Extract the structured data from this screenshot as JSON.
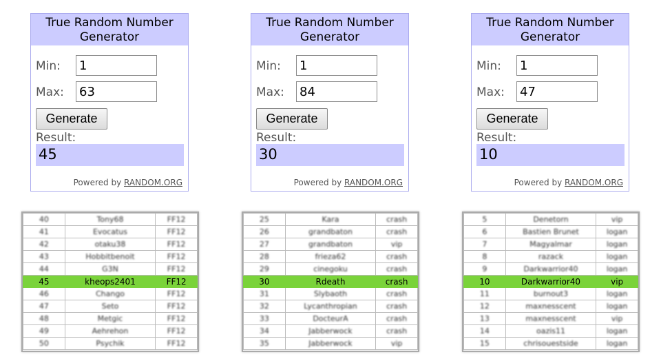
{
  "generators": [
    {
      "title": "True Random Number Generator",
      "min_label": "Min:",
      "min_value": "1",
      "max_label": "Max:",
      "max_value": "63",
      "button_label": "Generate",
      "result_label": "Result:",
      "result_value": "45",
      "powered_by": "Powered by",
      "powered_link": "RANDOM.ORG"
    },
    {
      "title": "True Random Number Generator",
      "min_label": "Min:",
      "min_value": "1",
      "max_label": "Max:",
      "max_value": "84",
      "button_label": "Generate",
      "result_label": "Result:",
      "result_value": "30",
      "powered_by": "Powered by",
      "powered_link": "RANDOM.ORG"
    },
    {
      "title": "True Random Number Generator",
      "min_label": "Min:",
      "min_value": "1",
      "max_label": "Max:",
      "max_value": "47",
      "button_label": "Generate",
      "result_label": "Result:",
      "result_value": "10",
      "powered_by": "Powered by",
      "powered_link": "RANDOM.ORG"
    }
  ],
  "tables": [
    {
      "highlight_row": 5,
      "rows": [
        [
          "40",
          "Tony68",
          "FF12"
        ],
        [
          "41",
          "Evocatus",
          "FF12"
        ],
        [
          "42",
          "otaku38",
          "FF12"
        ],
        [
          "43",
          "Hobbitbenoit",
          "FF12"
        ],
        [
          "44",
          "G3N",
          "FF12"
        ],
        [
          "45",
          "kheops2401",
          "FF12"
        ],
        [
          "46",
          "Chango",
          "FF12"
        ],
        [
          "47",
          "Seto",
          "FF12"
        ],
        [
          "48",
          "Metgic",
          "FF12"
        ],
        [
          "49",
          "Aehrehon",
          "FF12"
        ],
        [
          "50",
          "Psychik",
          "FF12"
        ]
      ]
    },
    {
      "highlight_row": 5,
      "rows": [
        [
          "25",
          "Kara",
          "crash"
        ],
        [
          "26",
          "grandbaton",
          "crash"
        ],
        [
          "27",
          "grandbaton",
          "vip"
        ],
        [
          "28",
          "frieza62",
          "crash"
        ],
        [
          "29",
          "cinegoku",
          "crash"
        ],
        [
          "30",
          "Rdeath",
          "crash"
        ],
        [
          "31",
          "Slybaoth",
          "crash"
        ],
        [
          "32",
          "Lycanthropian",
          "crash"
        ],
        [
          "33",
          "DocteurA",
          "crash"
        ],
        [
          "34",
          "Jabberwock",
          "crash"
        ],
        [
          "35",
          "Jabberwock",
          "vip"
        ]
      ]
    },
    {
      "highlight_row": 5,
      "rows": [
        [
          "5",
          "Denetorn",
          "vip"
        ],
        [
          "6",
          "Bastien Brunet",
          "logan"
        ],
        [
          "7",
          "Magyalmar",
          "logan"
        ],
        [
          "8",
          "razack",
          "logan"
        ],
        [
          "9",
          "Darkwarrior40",
          "logan"
        ],
        [
          "10",
          "Darkwarrior40",
          "vip"
        ],
        [
          "11",
          "burnout3",
          "logan"
        ],
        [
          "12",
          "maxnesscent",
          "logan"
        ],
        [
          "13",
          "maxnesscent",
          "vip"
        ],
        [
          "14",
          "oazis11",
          "logan"
        ],
        [
          "15",
          "chrisouestside",
          "logan"
        ]
      ]
    }
  ]
}
